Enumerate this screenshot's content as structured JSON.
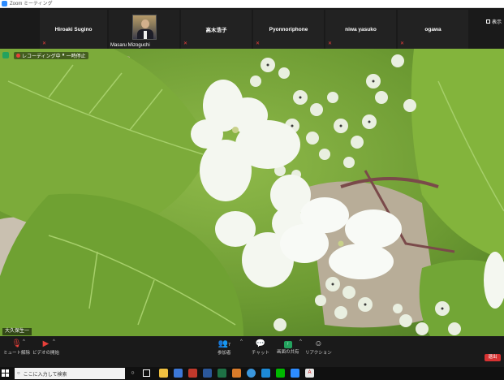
{
  "window": {
    "title": "Zoom ミーティング"
  },
  "participants": [
    {
      "name": "Hiroaki Sugino",
      "has_video": false
    },
    {
      "name": "Masaru Mizoguchi",
      "has_video": true
    },
    {
      "name": "高木浩子",
      "has_video": false
    },
    {
      "name": "Pyonnoriphone",
      "has_video": false
    },
    {
      "name": "niwa yasuko",
      "has_video": false
    },
    {
      "name": "ogawa",
      "has_video": false
    }
  ],
  "view_button": {
    "label": "表示"
  },
  "recording": {
    "label": "レコーディング中",
    "pause_label": "一時停止"
  },
  "speaker": {
    "name": "大久保生一"
  },
  "toolbar": {
    "mute": "ミュート解除",
    "video": "ビデオの開始",
    "participants": "参加者",
    "participants_count": "7",
    "chat": "チャット",
    "share": "画面の共有",
    "reactions": "リアクション",
    "end": "退出"
  },
  "taskbar": {
    "search_placeholder": "ここに入力して検索"
  },
  "colors": {
    "accent_red": "#e8403a",
    "share_green": "#23a25e",
    "end_red": "#d63232"
  }
}
